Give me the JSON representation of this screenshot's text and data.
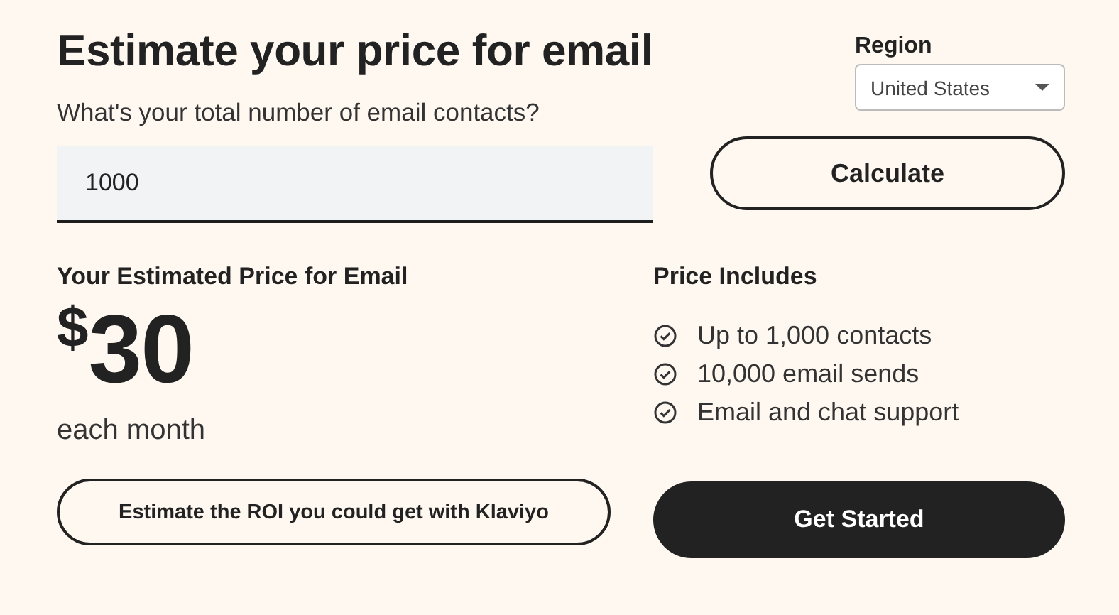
{
  "title": "Estimate your price for email",
  "region": {
    "label": "Region",
    "value": "United States"
  },
  "contacts": {
    "label": "What's your total number of email contacts?",
    "value": "1000"
  },
  "calculate_button": "Calculate",
  "estimate": {
    "label": "Your Estimated Price for Email",
    "currency": "$",
    "amount": "30",
    "period": "each month"
  },
  "includes": {
    "heading": "Price Includes",
    "items": [
      {
        "text": "Up to 1,000 contacts"
      },
      {
        "text": "10,000 email sends"
      },
      {
        "text": "Email and chat support"
      }
    ]
  },
  "roi_button": "Estimate the ROI you could get with Klaviyo",
  "start_button": "Get Started"
}
